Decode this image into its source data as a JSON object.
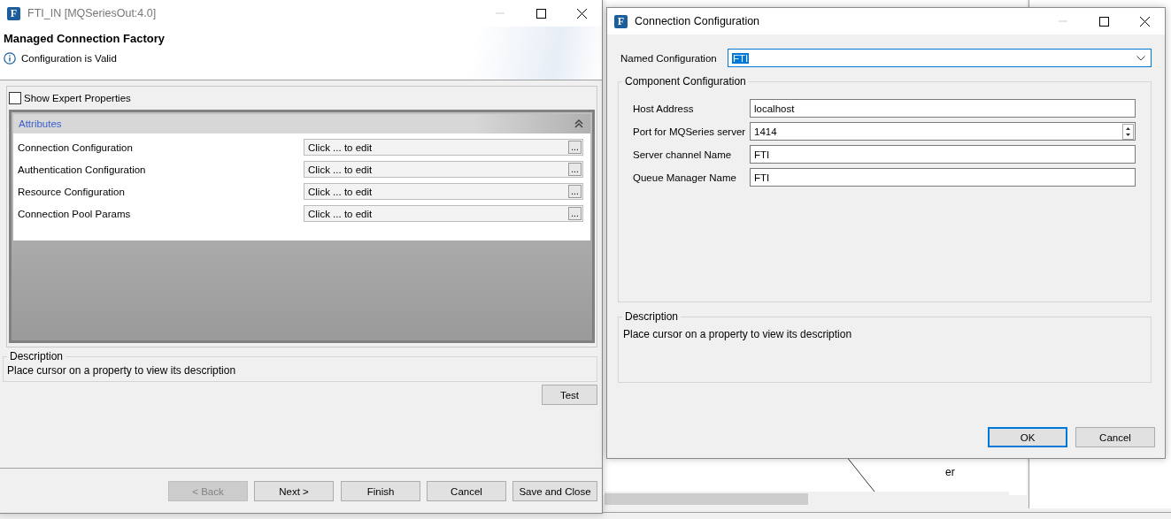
{
  "background": {
    "canvas_label": "er"
  },
  "left_window": {
    "app_icon": "F",
    "title": "FTI_IN [MQSeriesOut:4.0]",
    "heading": "Managed Connection Factory",
    "status": "Configuration is Valid",
    "expert_toggle": {
      "label": "Show Expert Properties",
      "checked": false
    },
    "attributes": {
      "title": "Attributes",
      "expanded": true,
      "rows": [
        {
          "label": "Connection Configuration",
          "value": "Click ... to edit",
          "button": "..."
        },
        {
          "label": "Authentication Configuration",
          "value": "Click ... to edit",
          "button": "..."
        },
        {
          "label": "Resource Configuration",
          "value": "Click ... to edit",
          "button": "..."
        },
        {
          "label": "Connection Pool Params",
          "value": "Click ... to edit",
          "button": "..."
        }
      ]
    },
    "description": {
      "title": "Description",
      "text": "Place cursor on a property to view its description"
    },
    "test_button": "Test",
    "buttons": [
      {
        "label": "< Back",
        "disabled": true
      },
      {
        "label": "Next >",
        "disabled": false
      },
      {
        "label": "Finish",
        "disabled": false
      },
      {
        "label": "Cancel",
        "disabled": false
      },
      {
        "label": "Save and Close",
        "disabled": false
      }
    ]
  },
  "right_window": {
    "app_icon": "F",
    "title": "Connection Configuration",
    "named_configuration": {
      "label": "Named Configuration",
      "value": "FTI"
    },
    "component_configuration": {
      "title": "Component Configuration",
      "fields": [
        {
          "kind": "text",
          "label": "Host Address",
          "value": "localhost"
        },
        {
          "kind": "spinner",
          "label": "Port for MQSeries server",
          "value": "1414"
        },
        {
          "kind": "text",
          "label": "Server channel Name",
          "value": "FTI"
        },
        {
          "kind": "text",
          "label": "Queue Manager Name",
          "value": "FTI"
        }
      ]
    },
    "description": {
      "title": "Description",
      "text": "Place cursor on a property to view its description"
    },
    "buttons": [
      {
        "label": "OK",
        "default": true
      },
      {
        "label": "Cancel",
        "default": false
      }
    ]
  }
}
